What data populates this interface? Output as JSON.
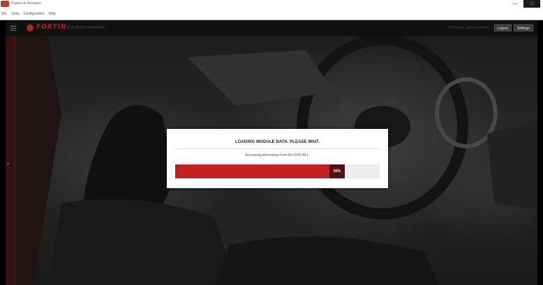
{
  "window": {
    "title": "FlashLink Manager"
  },
  "menu": {
    "items": [
      "File",
      "Tools",
      "Configuration",
      "Help"
    ]
  },
  "header": {
    "brand": "FORTIN",
    "tagline": "FLASHLINK MANAGER",
    "status": "Not found · Not connected",
    "logout_label": "Logout",
    "settings_label": "Settings"
  },
  "dialog": {
    "title": "LOADING MODULE DATA. PLEASE WAIT.",
    "message": "Accessing information from the EVO-ALL.",
    "progress_label": "83%",
    "progress_value": 0.83
  },
  "colors": {
    "accent": "#c21f1f",
    "accent_dark": "#521212",
    "brand": "#b32424"
  },
  "icons": {
    "menu": "hamburger-icon",
    "expand": "chevron-right-icon",
    "logo": "fortin-logo-icon"
  }
}
